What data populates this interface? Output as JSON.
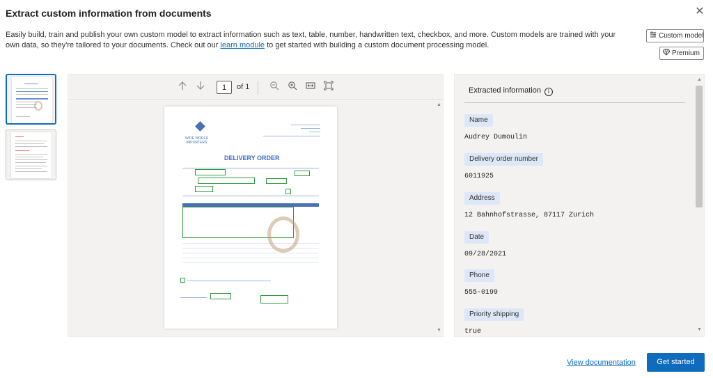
{
  "dialog": {
    "title": "Extract custom information from documents",
    "close_icon": "close-icon",
    "description_pre": "Easily build, train and publish your own custom model to extract information such as text, table, number, handwritten text, checkbox, and more. Custom models are trained with your own data, so they're tailored to your documents. Check out our ",
    "description_link": "learn module",
    "description_post": " to get started with building a custom document processing model."
  },
  "tags": {
    "custom_model": "Custom model",
    "premium": "Premium"
  },
  "viewer": {
    "current_page": "1",
    "of_label": "of 1"
  },
  "document": {
    "title": "DELIVERY ORDER",
    "logo_text_1": "WIDE WORLD",
    "logo_text_2": "IMPORTERS"
  },
  "info": {
    "header": "Extracted information",
    "fields": [
      {
        "label": "Name",
        "value": "Audrey Dumoulin"
      },
      {
        "label": "Delivery order number",
        "value": "6011925"
      },
      {
        "label": "Address",
        "value": "12 Bahnhofstrasse, 87117 Zurich"
      },
      {
        "label": "Date",
        "value": "09/28/2021"
      },
      {
        "label": "Phone",
        "value": "555-0199"
      },
      {
        "label": "Priority shipping",
        "value": "true"
      }
    ]
  },
  "footer": {
    "view_docs": "View documentation",
    "get_started": "Get started"
  },
  "colors": {
    "accent": "#0f6cbd",
    "label_bg": "#dce8f7",
    "panel_bg": "#f3f2f1",
    "detection_box": "#2f9c3b"
  }
}
